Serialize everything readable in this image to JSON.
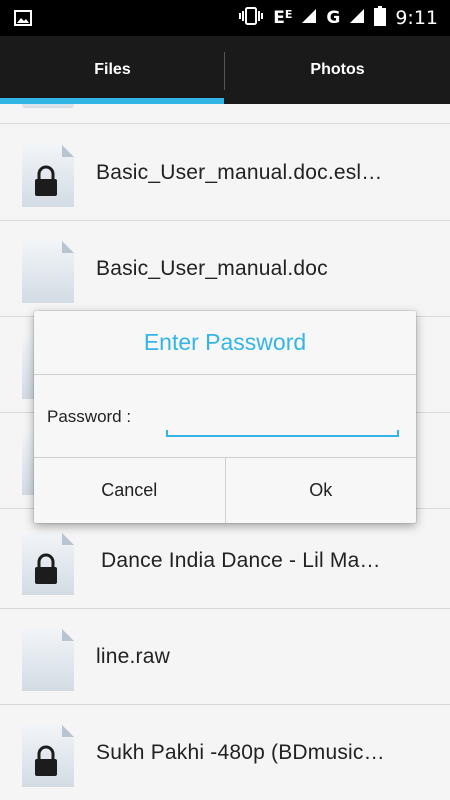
{
  "status_bar": {
    "time": "9:11",
    "network_label": "G",
    "network_e": "E",
    "icons": [
      "image-icon",
      "vibrate-icon",
      "signal-icon",
      "battery-icon"
    ]
  },
  "tabs": [
    {
      "label": "Files",
      "selected": true
    },
    {
      "label": "Photos",
      "selected": false
    }
  ],
  "accent_color": "#33b5e5",
  "files": [
    {
      "name": "Basic_User_manual.doc.esl…",
      "locked": true
    },
    {
      "name": "Basic_User_manual.doc",
      "locked": false
    },
    {
      "name": "",
      "locked": true
    },
    {
      "name": "",
      "locked": false
    },
    {
      "name": "Dance India Dance - Lil Ma…",
      "locked": true
    },
    {
      "name": "line.raw",
      "locked": false
    },
    {
      "name": "Sukh Pakhi -480p (BDmusic…",
      "locked": true
    }
  ],
  "dialog": {
    "title": "Enter Password",
    "password_label": "Password :",
    "password_value": "",
    "cancel_label": "Cancel",
    "ok_label": "Ok"
  }
}
